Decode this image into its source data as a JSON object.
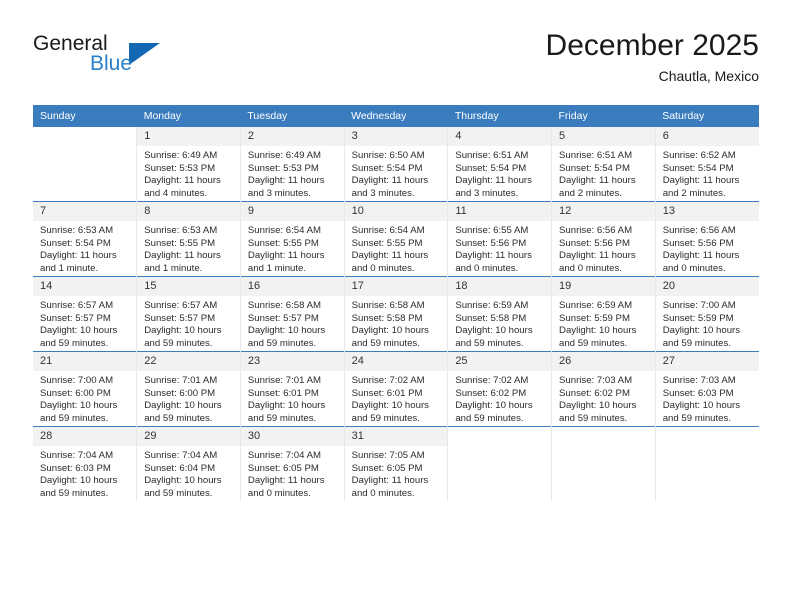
{
  "brand": {
    "name_primary": "General",
    "name_secondary": "Blue",
    "flag_icon": "brand-flag-icon",
    "accent_color": "#1268b3"
  },
  "header": {
    "title": "December 2025",
    "location": "Chautla, Mexico"
  },
  "calendar": {
    "header_color": "#3a7cbe",
    "daynum_background": "#f2f2f2",
    "weekdays": [
      "Sunday",
      "Monday",
      "Tuesday",
      "Wednesday",
      "Thursday",
      "Friday",
      "Saturday"
    ],
    "weeks": [
      [
        {
          "empty": true
        },
        {
          "day": "1",
          "sunrise": "Sunrise: 6:49 AM",
          "sunset": "Sunset: 5:53 PM",
          "daylight_1": "Daylight: 11 hours",
          "daylight_2": "and 4 minutes."
        },
        {
          "day": "2",
          "sunrise": "Sunrise: 6:49 AM",
          "sunset": "Sunset: 5:53 PM",
          "daylight_1": "Daylight: 11 hours",
          "daylight_2": "and 3 minutes."
        },
        {
          "day": "3",
          "sunrise": "Sunrise: 6:50 AM",
          "sunset": "Sunset: 5:54 PM",
          "daylight_1": "Daylight: 11 hours",
          "daylight_2": "and 3 minutes."
        },
        {
          "day": "4",
          "sunrise": "Sunrise: 6:51 AM",
          "sunset": "Sunset: 5:54 PM",
          "daylight_1": "Daylight: 11 hours",
          "daylight_2": "and 3 minutes."
        },
        {
          "day": "5",
          "sunrise": "Sunrise: 6:51 AM",
          "sunset": "Sunset: 5:54 PM",
          "daylight_1": "Daylight: 11 hours",
          "daylight_2": "and 2 minutes."
        },
        {
          "day": "6",
          "sunrise": "Sunrise: 6:52 AM",
          "sunset": "Sunset: 5:54 PM",
          "daylight_1": "Daylight: 11 hours",
          "daylight_2": "and 2 minutes."
        }
      ],
      [
        {
          "day": "7",
          "sunrise": "Sunrise: 6:53 AM",
          "sunset": "Sunset: 5:54 PM",
          "daylight_1": "Daylight: 11 hours",
          "daylight_2": "and 1 minute."
        },
        {
          "day": "8",
          "sunrise": "Sunrise: 6:53 AM",
          "sunset": "Sunset: 5:55 PM",
          "daylight_1": "Daylight: 11 hours",
          "daylight_2": "and 1 minute."
        },
        {
          "day": "9",
          "sunrise": "Sunrise: 6:54 AM",
          "sunset": "Sunset: 5:55 PM",
          "daylight_1": "Daylight: 11 hours",
          "daylight_2": "and 1 minute."
        },
        {
          "day": "10",
          "sunrise": "Sunrise: 6:54 AM",
          "sunset": "Sunset: 5:55 PM",
          "daylight_1": "Daylight: 11 hours",
          "daylight_2": "and 0 minutes."
        },
        {
          "day": "11",
          "sunrise": "Sunrise: 6:55 AM",
          "sunset": "Sunset: 5:56 PM",
          "daylight_1": "Daylight: 11 hours",
          "daylight_2": "and 0 minutes."
        },
        {
          "day": "12",
          "sunrise": "Sunrise: 6:56 AM",
          "sunset": "Sunset: 5:56 PM",
          "daylight_1": "Daylight: 11 hours",
          "daylight_2": "and 0 minutes."
        },
        {
          "day": "13",
          "sunrise": "Sunrise: 6:56 AM",
          "sunset": "Sunset: 5:56 PM",
          "daylight_1": "Daylight: 11 hours",
          "daylight_2": "and 0 minutes."
        }
      ],
      [
        {
          "day": "14",
          "sunrise": "Sunrise: 6:57 AM",
          "sunset": "Sunset: 5:57 PM",
          "daylight_1": "Daylight: 10 hours",
          "daylight_2": "and 59 minutes."
        },
        {
          "day": "15",
          "sunrise": "Sunrise: 6:57 AM",
          "sunset": "Sunset: 5:57 PM",
          "daylight_1": "Daylight: 10 hours",
          "daylight_2": "and 59 minutes."
        },
        {
          "day": "16",
          "sunrise": "Sunrise: 6:58 AM",
          "sunset": "Sunset: 5:57 PM",
          "daylight_1": "Daylight: 10 hours",
          "daylight_2": "and 59 minutes."
        },
        {
          "day": "17",
          "sunrise": "Sunrise: 6:58 AM",
          "sunset": "Sunset: 5:58 PM",
          "daylight_1": "Daylight: 10 hours",
          "daylight_2": "and 59 minutes."
        },
        {
          "day": "18",
          "sunrise": "Sunrise: 6:59 AM",
          "sunset": "Sunset: 5:58 PM",
          "daylight_1": "Daylight: 10 hours",
          "daylight_2": "and 59 minutes."
        },
        {
          "day": "19",
          "sunrise": "Sunrise: 6:59 AM",
          "sunset": "Sunset: 5:59 PM",
          "daylight_1": "Daylight: 10 hours",
          "daylight_2": "and 59 minutes."
        },
        {
          "day": "20",
          "sunrise": "Sunrise: 7:00 AM",
          "sunset": "Sunset: 5:59 PM",
          "daylight_1": "Daylight: 10 hours",
          "daylight_2": "and 59 minutes."
        }
      ],
      [
        {
          "day": "21",
          "sunrise": "Sunrise: 7:00 AM",
          "sunset": "Sunset: 6:00 PM",
          "daylight_1": "Daylight: 10 hours",
          "daylight_2": "and 59 minutes."
        },
        {
          "day": "22",
          "sunrise": "Sunrise: 7:01 AM",
          "sunset": "Sunset: 6:00 PM",
          "daylight_1": "Daylight: 10 hours",
          "daylight_2": "and 59 minutes."
        },
        {
          "day": "23",
          "sunrise": "Sunrise: 7:01 AM",
          "sunset": "Sunset: 6:01 PM",
          "daylight_1": "Daylight: 10 hours",
          "daylight_2": "and 59 minutes."
        },
        {
          "day": "24",
          "sunrise": "Sunrise: 7:02 AM",
          "sunset": "Sunset: 6:01 PM",
          "daylight_1": "Daylight: 10 hours",
          "daylight_2": "and 59 minutes."
        },
        {
          "day": "25",
          "sunrise": "Sunrise: 7:02 AM",
          "sunset": "Sunset: 6:02 PM",
          "daylight_1": "Daylight: 10 hours",
          "daylight_2": "and 59 minutes."
        },
        {
          "day": "26",
          "sunrise": "Sunrise: 7:03 AM",
          "sunset": "Sunset: 6:02 PM",
          "daylight_1": "Daylight: 10 hours",
          "daylight_2": "and 59 minutes."
        },
        {
          "day": "27",
          "sunrise": "Sunrise: 7:03 AM",
          "sunset": "Sunset: 6:03 PM",
          "daylight_1": "Daylight: 10 hours",
          "daylight_2": "and 59 minutes."
        }
      ],
      [
        {
          "day": "28",
          "sunrise": "Sunrise: 7:04 AM",
          "sunset": "Sunset: 6:03 PM",
          "daylight_1": "Daylight: 10 hours",
          "daylight_2": "and 59 minutes."
        },
        {
          "day": "29",
          "sunrise": "Sunrise: 7:04 AM",
          "sunset": "Sunset: 6:04 PM",
          "daylight_1": "Daylight: 10 hours",
          "daylight_2": "and 59 minutes."
        },
        {
          "day": "30",
          "sunrise": "Sunrise: 7:04 AM",
          "sunset": "Sunset: 6:05 PM",
          "daylight_1": "Daylight: 11 hours",
          "daylight_2": "and 0 minutes."
        },
        {
          "day": "31",
          "sunrise": "Sunrise: 7:05 AM",
          "sunset": "Sunset: 6:05 PM",
          "daylight_1": "Daylight: 11 hours",
          "daylight_2": "and 0 minutes."
        },
        {
          "empty": true
        },
        {
          "empty": true
        },
        {
          "empty": true
        }
      ]
    ]
  }
}
